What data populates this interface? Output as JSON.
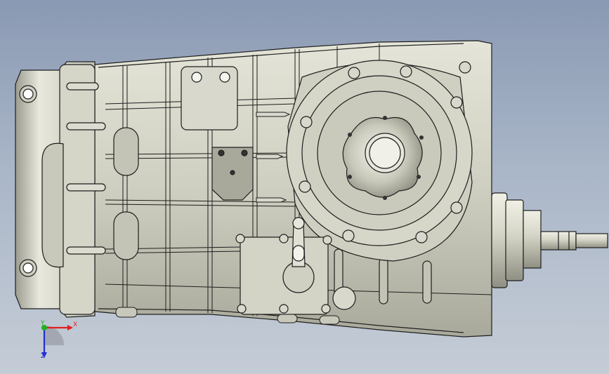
{
  "viewport": {
    "background_top": "#8a99b3",
    "background_bottom": "#c5ccd6",
    "model": {
      "description_icon": "gearbox-housing-3d-model",
      "face_color": "#d3d3c5",
      "edge_color": "#1e1e1e",
      "shadow_color": "#8e8e82"
    }
  },
  "triad": {
    "x_label": "X",
    "y_label": "Y",
    "z_label": "Z",
    "x_color": "#e02020",
    "y_color": "#20b020",
    "z_color": "#2030d0"
  }
}
